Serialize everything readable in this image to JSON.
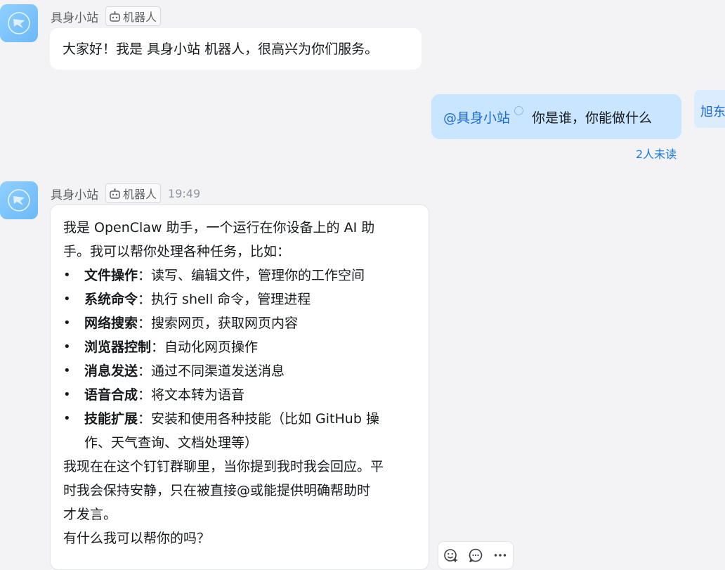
{
  "message1": {
    "sender": "具身小站",
    "tag": "机器人",
    "text": "大家好！我是 具身小站 机器人，很高兴为你们服务。"
  },
  "message2": {
    "mention": "@具身小站",
    "text": "你是谁，你能做什么",
    "read_status": "2人未读",
    "peer_name": "旭东"
  },
  "message3": {
    "sender": "具身小站",
    "tag": "机器人",
    "time": "19:49",
    "intro_line1": "我是 OpenClaw 助手，一个运行在你设备上的 AI 助",
    "intro_line2": "手。我可以帮你处理各种任务，比如：",
    "bullets": [
      {
        "title": "文件操作",
        "desc": "：读写、编辑文件，管理你的工作空间"
      },
      {
        "title": "系统命令",
        "desc": "：执行 shell 命令，管理进程"
      },
      {
        "title": "网络搜索",
        "desc": "：搜索网页，获取网页内容"
      },
      {
        "title": "浏览器控制",
        "desc": "：自动化网页操作"
      },
      {
        "title": "消息发送",
        "desc": "：通过不同渠道发送消息"
      },
      {
        "title": "语音合成",
        "desc": "：将文本转为语音"
      },
      {
        "title": "技能扩展",
        "desc": "：安装和使用各种技能（比如 GitHub 操",
        "desc2": "作、天气查询、文档处理等）"
      }
    ],
    "outro_line1": "我现在在这个钉钉群聊里，当你提到我时我会回应。平",
    "outro_line2": "时我会保持安静，只在被直接@或能提供明确帮助时",
    "outro_line3": "才发言。",
    "closing": "有什么我可以帮你的吗？"
  },
  "colors": {
    "background": "#f3f3f5",
    "bubble_self": "#c9e5ff",
    "mention": "#1b6bd8",
    "avatar": "#7cc2fb"
  },
  "icons": [
    "bot-icon",
    "add-reaction-icon",
    "reply-comment-icon",
    "more-icon"
  ]
}
